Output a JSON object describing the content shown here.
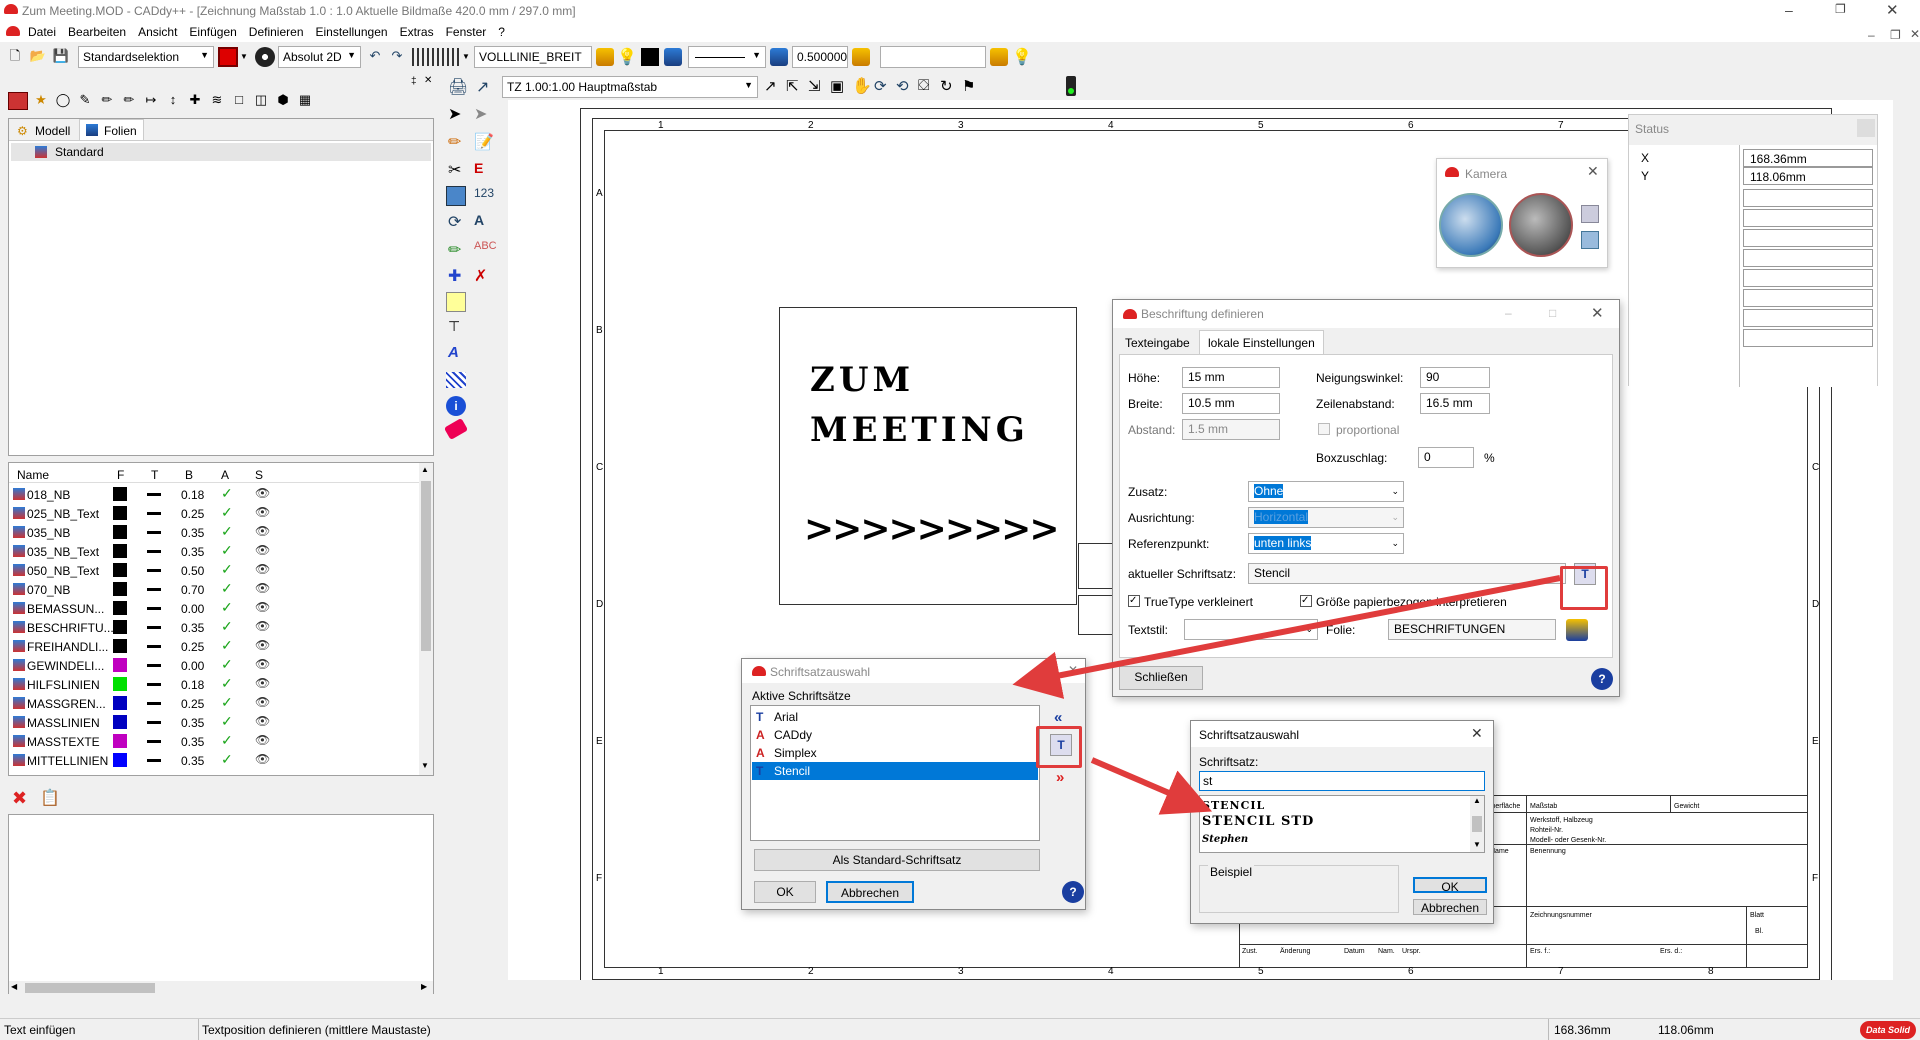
{
  "window": {
    "title": "Zum Meeting.MOD  -  CADdy++ - [Zeichnung   Maßstab 1.0 : 1.0   Aktuelle Bildmaße 420.0 mm / 297.0 mm]"
  },
  "menu": [
    "Datei",
    "Bearbeiten",
    "Ansicht",
    "Einfügen",
    "Definieren",
    "Einstellungen",
    "Extras",
    "Fenster",
    "?"
  ],
  "toolbar": {
    "selection": "Standardselektion",
    "coord_mode": "Absolut 2D",
    "linetype": "VOLLLINIE_BREIT",
    "linewidth": "0.500000",
    "scale": "TZ 1.00:1.00 Hauptmaßstab"
  },
  "left_tabs": [
    "Modell",
    "Folien"
  ],
  "tree_item": "Standard",
  "layer_headers": [
    "Name",
    "F",
    "T",
    "B",
    "A",
    "S"
  ],
  "layers": [
    {
      "name": "018_NB",
      "color": "#000000",
      "width": "0.18"
    },
    {
      "name": "025_NB_Text",
      "color": "#000000",
      "width": "0.25"
    },
    {
      "name": "035_NB",
      "color": "#000000",
      "width": "0.35"
    },
    {
      "name": "035_NB_Text",
      "color": "#000000",
      "width": "0.35"
    },
    {
      "name": "050_NB_Text",
      "color": "#000000",
      "width": "0.50"
    },
    {
      "name": "070_NB",
      "color": "#000000",
      "width": "0.70"
    },
    {
      "name": "BEMASSUN...",
      "color": "#000000",
      "width": "0.00"
    },
    {
      "name": "BESCHRIFTU...",
      "color": "#000000",
      "width": "0.35"
    },
    {
      "name": "FREIHANDLI...",
      "color": "#000000",
      "width": "0.25"
    },
    {
      "name": "GEWINDELI...",
      "color": "#c000c0",
      "width": "0.00"
    },
    {
      "name": "HILFSLINIEN",
      "color": "#00e000",
      "width": "0.18"
    },
    {
      "name": "MASSGREN...",
      "color": "#0000c0",
      "width": "0.25"
    },
    {
      "name": "MASSLINIEN",
      "color": "#0000c0",
      "width": "0.35"
    },
    {
      "name": "MASSTEXTE",
      "color": "#c000c0",
      "width": "0.35"
    },
    {
      "name": "MITTELLINIEN",
      "color": "#0000ff",
      "width": "0.35"
    }
  ],
  "drawing": {
    "text1": "ZUM",
    "text2": "MEETING",
    "text3": ">>>>>>>>>",
    "ruler_cols": [
      "1",
      "2",
      "3",
      "4",
      "5",
      "6",
      "7",
      "8"
    ],
    "ruler_rows": [
      "A",
      "B",
      "C",
      "D",
      "E",
      "F"
    ],
    "tb_masstab": "Maßstab",
    "tb_gewicht": "Gewicht",
    "tb_werkstoff": "Werkstoff, Halbzeug",
    "tb_rohteil": "Rohteil-Nr.",
    "tb_modell": "Modell- oder Gesenk-Nr.",
    "tb_name": "Name",
    "tb_benennung": "Benennung",
    "tb_zeichnung": "Zeichnungsnummer",
    "tb_blatt": "Blatt",
    "tb_bl": "Bl.",
    "tb_zust": "Zust.",
    "tb_aend": "Änderung",
    "tb_datum": "Datum",
    "tb_nam": "Nam.",
    "tb_urspr": "Urspr.",
    "tb_ersf": "Ers. f.:",
    "tb_ersd": "Ers. d.:",
    "tb_oberfl": "Oberfläche"
  },
  "kamera": {
    "title": "Kamera"
  },
  "status_panel": {
    "title": "Status",
    "x_label": "X",
    "x_value": "168.36mm",
    "y_label": "Y",
    "y_value": "118.06mm"
  },
  "beschriftung": {
    "title": "Beschriftung definieren",
    "tabs": [
      "Texteingabe",
      "lokale Einstellungen"
    ],
    "hoehe_label": "Höhe:",
    "hoehe": "15 mm",
    "breite_label": "Breite:",
    "breite": "10.5 mm",
    "abstand_label": "Abstand:",
    "abstand": "1.5 mm",
    "neigung_label": "Neigungswinkel:",
    "neigung": "90",
    "zeilen_label": "Zeilenabstand:",
    "zeilen": "16.5 mm",
    "proportional": "proportional",
    "box_label": "Boxzuschlag:",
    "box": "0",
    "percent": "%",
    "zusatz_label": "Zusatz:",
    "zusatz": "Ohne",
    "ausrichtung_label": "Ausrichtung:",
    "ausrichtung": "Horizontal",
    "ref_label": "Referenzpunkt:",
    "ref": "unten links",
    "schrift_label": "aktueller Schriftsatz:",
    "schrift": "Stencil",
    "truetype": "TrueType verkleinert",
    "groesse": "Größe papierbezogen interpretieren",
    "textstil_label": "Textstil:",
    "folie_label": "Folie:",
    "folie": "BESCHRIFTUNGEN",
    "close": "Schließen"
  },
  "schriftsatz1": {
    "title": "Schriftsatzauswahl",
    "group": "Aktive Schriftsätze",
    "items": [
      "Arial",
      "CADdy",
      "Simplex",
      "Stencil"
    ],
    "selected": "Stencil",
    "std_btn": "Als Standard-Schriftsatz",
    "ok": "OK",
    "cancel": "Abbrechen"
  },
  "schriftsatz2": {
    "title": "Schriftsatzauswahl",
    "label": "Schriftsatz:",
    "input": "st",
    "items": [
      "STENCIL",
      "STENCIL STD",
      "Stephen"
    ],
    "beispiel": "Beispiel",
    "ok": "OK",
    "cancel": "Abbrechen"
  },
  "statusbar": {
    "left": "Text einfügen",
    "middle": "Textposition definieren (mittlere Maustaste)",
    "x": "168.36mm",
    "y": "118.06mm",
    "logo": "Data Solid"
  }
}
